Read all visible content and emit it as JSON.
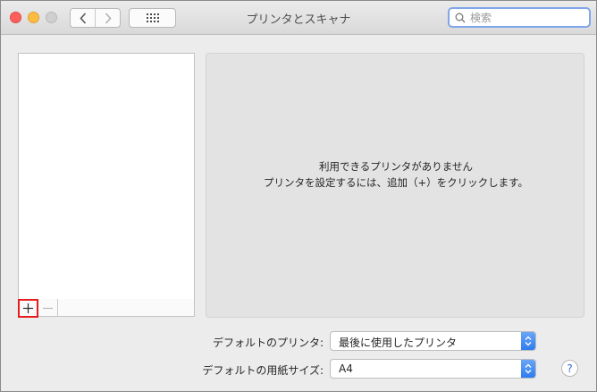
{
  "window": {
    "title": "プリンタとスキャナ"
  },
  "search": {
    "placeholder": "検索",
    "value": ""
  },
  "printer_list": {
    "items": [],
    "add_label": "+",
    "remove_label": "−"
  },
  "detail": {
    "message_line1": "利用できるプリンタがありません",
    "message_line2": "プリンタを設定するには、追加（+）をクリックします。"
  },
  "settings": {
    "default_printer_label": "デフォルトのプリンタ:",
    "default_printer_value": "最後に使用したプリンタ",
    "default_paper_label": "デフォルトの用紙サイズ:",
    "default_paper_value": "A4"
  },
  "help": {
    "label": "?"
  },
  "colors": {
    "close": "#fc605c",
    "minimize": "#fdbc40",
    "zoom_disabled": "#cfcfcf",
    "accent": "#2f7cf0",
    "highlight_border": "#e41e1e"
  },
  "icons": {
    "back": "chevron-left-icon",
    "forward": "chevron-right-icon",
    "show_all": "grid-icon",
    "search": "search-icon",
    "popup": "up-down-chevron-icon"
  }
}
